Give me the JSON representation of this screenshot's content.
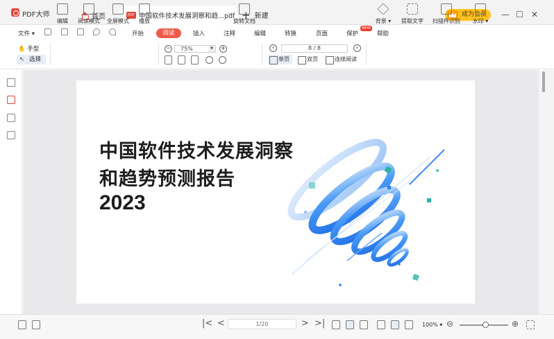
{
  "app": {
    "name": "PDF大师"
  },
  "tabs": {
    "home_label": "首页",
    "doc_label": "中国软件技术发展洞察和趋...pdf",
    "new_label": "新建",
    "close_icon": "×"
  },
  "header": {
    "vip_label": "成为会员"
  },
  "window": {
    "minimize": "—",
    "maximize": "☐",
    "close": "✕"
  },
  "menu": {
    "file": "文件 ▾",
    "start": "开始",
    "read": "阅读",
    "insert": "插入",
    "annotate": "注释",
    "edit": "编辑",
    "convert": "转换",
    "page": "页面",
    "protect": "保护",
    "protect_badge": "NEW",
    "help": "帮助"
  },
  "toolbar": {
    "hand": "手型",
    "select": "选择",
    "edit": "编辑",
    "read_mode": "阅读模式",
    "fullscreen": "全屏模式",
    "play": "播放",
    "zoom_value": "75%",
    "rotate_doc": "旋转文档",
    "page_indicator": "8 / 8",
    "single_page": "单页",
    "double_page": "双页",
    "continuous": "连续阅读",
    "background": "背景 ▾",
    "extract_text": "提取文字",
    "scan_ocr": "扫描件识别",
    "watermark": "水印 ▾"
  },
  "document": {
    "title_line1": "中国软件技术发展洞察",
    "title_line2": "和趋势预测报告",
    "year": "2023"
  },
  "statusbar": {
    "page_input": "1/20",
    "zoom": "100% ▾",
    "first": "|<",
    "prev": "<",
    "next": ">",
    "last": ">|",
    "zoom_out": "⊖",
    "zoom_in": "⊕"
  },
  "colors": {
    "accent": "#f05a4a",
    "brand": "#e5453a",
    "vip": "#ffc21f"
  }
}
